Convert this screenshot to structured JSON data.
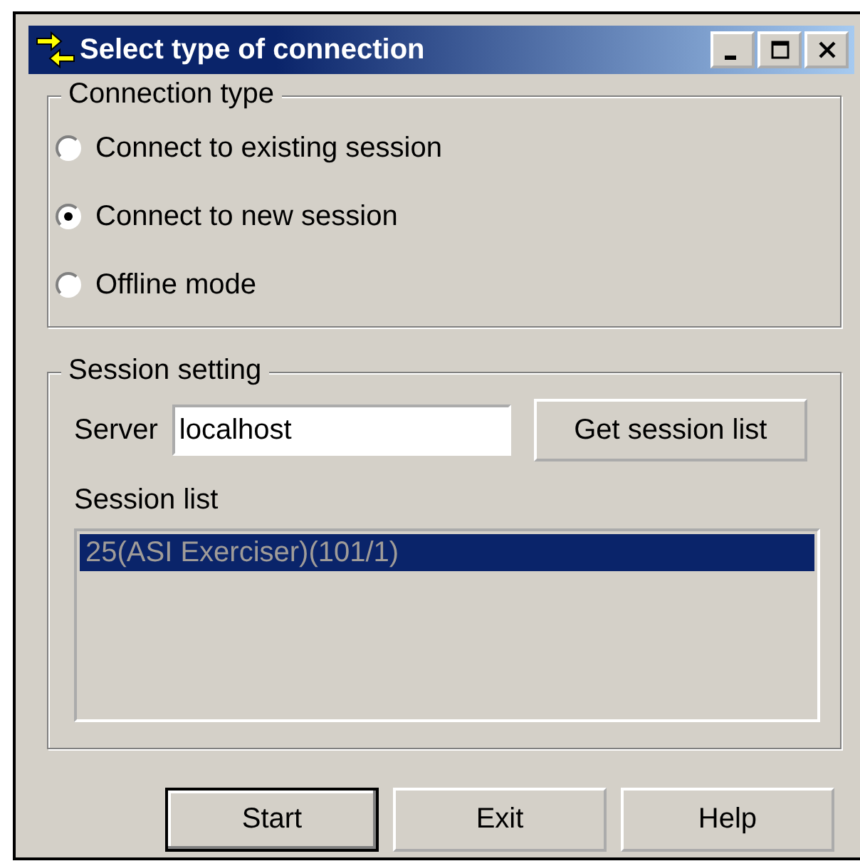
{
  "window": {
    "title": "Select type of connection",
    "controls": [
      {
        "kind": "minimize"
      },
      {
        "kind": "maximize"
      },
      {
        "kind": "close"
      }
    ]
  },
  "connection_type": {
    "label": "Connection type",
    "options": [
      {
        "label": "Connect to existing session",
        "selected": false
      },
      {
        "label": "Connect to new session",
        "selected": true
      },
      {
        "label": "Offline mode",
        "selected": false
      }
    ]
  },
  "session_setting": {
    "label": "Session setting",
    "server_label": "Server",
    "server_value": "localhost",
    "get_button": "Get session list",
    "list_label": "Session list",
    "sessions": [
      {
        "label": "25(ASI Exerciser)(101/1)",
        "selected": true
      }
    ]
  },
  "buttons": [
    {
      "label": "Start",
      "default": true
    },
    {
      "label": "Exit",
      "default": false
    },
    {
      "label": "Help",
      "default": false
    }
  ]
}
